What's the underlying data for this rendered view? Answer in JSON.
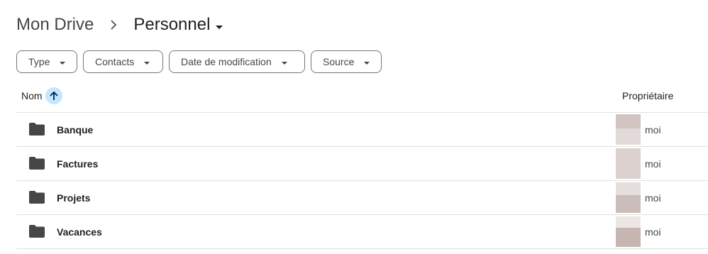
{
  "breadcrumb": {
    "root": "Mon Drive",
    "separator_icon": "chevron-right-icon",
    "current": "Personnel"
  },
  "filters": [
    {
      "label": "Type"
    },
    {
      "label": "Contacts"
    },
    {
      "label": "Date de modification"
    },
    {
      "label": "Source"
    }
  ],
  "header": {
    "name": "Nom",
    "owner": "Propriétaire",
    "sort_icon": "arrow-up-icon"
  },
  "rows": [
    {
      "name": "Banque",
      "owner": "moi",
      "icon": "folder-icon"
    },
    {
      "name": "Factures",
      "owner": "moi",
      "icon": "folder-icon"
    },
    {
      "name": "Projets",
      "owner": "moi",
      "icon": "folder-icon"
    },
    {
      "name": "Vacances",
      "owner": "moi",
      "icon": "folder-icon"
    }
  ],
  "colors": {
    "sort_badge": "#c2e7ff",
    "folder": "#444746",
    "divider": "#e0e0e0",
    "avatar_blur_a": "#d7cbc7",
    "avatar_blur_b": "#e8e2e0",
    "avatar_blur_c": "#c8bab6"
  }
}
